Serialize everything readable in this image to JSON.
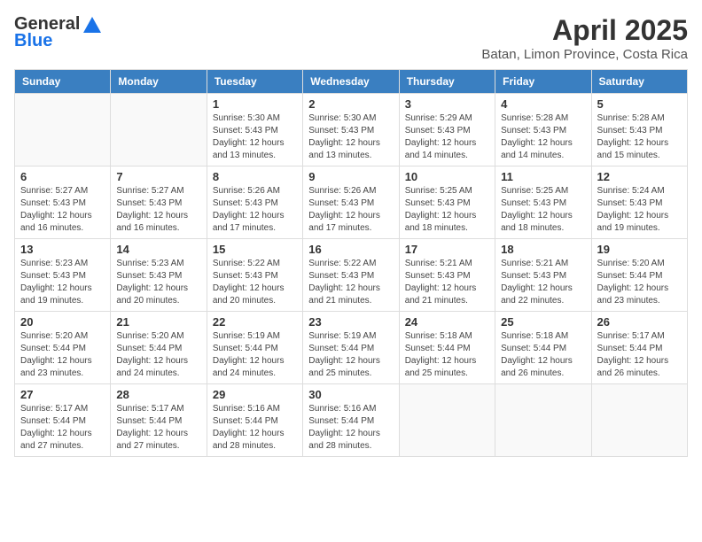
{
  "header": {
    "logo_general": "General",
    "logo_blue": "Blue",
    "month_title": "April 2025",
    "location": "Batan, Limon Province, Costa Rica"
  },
  "weekdays": [
    "Sunday",
    "Monday",
    "Tuesday",
    "Wednesday",
    "Thursday",
    "Friday",
    "Saturday"
  ],
  "weeks": [
    [
      {
        "day": "",
        "sunrise": "",
        "sunset": "",
        "daylight": ""
      },
      {
        "day": "",
        "sunrise": "",
        "sunset": "",
        "daylight": ""
      },
      {
        "day": "1",
        "sunrise": "Sunrise: 5:30 AM",
        "sunset": "Sunset: 5:43 PM",
        "daylight": "Daylight: 12 hours and 13 minutes."
      },
      {
        "day": "2",
        "sunrise": "Sunrise: 5:30 AM",
        "sunset": "Sunset: 5:43 PM",
        "daylight": "Daylight: 12 hours and 13 minutes."
      },
      {
        "day": "3",
        "sunrise": "Sunrise: 5:29 AM",
        "sunset": "Sunset: 5:43 PM",
        "daylight": "Daylight: 12 hours and 14 minutes."
      },
      {
        "day": "4",
        "sunrise": "Sunrise: 5:28 AM",
        "sunset": "Sunset: 5:43 PM",
        "daylight": "Daylight: 12 hours and 14 minutes."
      },
      {
        "day": "5",
        "sunrise": "Sunrise: 5:28 AM",
        "sunset": "Sunset: 5:43 PM",
        "daylight": "Daylight: 12 hours and 15 minutes."
      }
    ],
    [
      {
        "day": "6",
        "sunrise": "Sunrise: 5:27 AM",
        "sunset": "Sunset: 5:43 PM",
        "daylight": "Daylight: 12 hours and 16 minutes."
      },
      {
        "day": "7",
        "sunrise": "Sunrise: 5:27 AM",
        "sunset": "Sunset: 5:43 PM",
        "daylight": "Daylight: 12 hours and 16 minutes."
      },
      {
        "day": "8",
        "sunrise": "Sunrise: 5:26 AM",
        "sunset": "Sunset: 5:43 PM",
        "daylight": "Daylight: 12 hours and 17 minutes."
      },
      {
        "day": "9",
        "sunrise": "Sunrise: 5:26 AM",
        "sunset": "Sunset: 5:43 PM",
        "daylight": "Daylight: 12 hours and 17 minutes."
      },
      {
        "day": "10",
        "sunrise": "Sunrise: 5:25 AM",
        "sunset": "Sunset: 5:43 PM",
        "daylight": "Daylight: 12 hours and 18 minutes."
      },
      {
        "day": "11",
        "sunrise": "Sunrise: 5:25 AM",
        "sunset": "Sunset: 5:43 PM",
        "daylight": "Daylight: 12 hours and 18 minutes."
      },
      {
        "day": "12",
        "sunrise": "Sunrise: 5:24 AM",
        "sunset": "Sunset: 5:43 PM",
        "daylight": "Daylight: 12 hours and 19 minutes."
      }
    ],
    [
      {
        "day": "13",
        "sunrise": "Sunrise: 5:23 AM",
        "sunset": "Sunset: 5:43 PM",
        "daylight": "Daylight: 12 hours and 19 minutes."
      },
      {
        "day": "14",
        "sunrise": "Sunrise: 5:23 AM",
        "sunset": "Sunset: 5:43 PM",
        "daylight": "Daylight: 12 hours and 20 minutes."
      },
      {
        "day": "15",
        "sunrise": "Sunrise: 5:22 AM",
        "sunset": "Sunset: 5:43 PM",
        "daylight": "Daylight: 12 hours and 20 minutes."
      },
      {
        "day": "16",
        "sunrise": "Sunrise: 5:22 AM",
        "sunset": "Sunset: 5:43 PM",
        "daylight": "Daylight: 12 hours and 21 minutes."
      },
      {
        "day": "17",
        "sunrise": "Sunrise: 5:21 AM",
        "sunset": "Sunset: 5:43 PM",
        "daylight": "Daylight: 12 hours and 21 minutes."
      },
      {
        "day": "18",
        "sunrise": "Sunrise: 5:21 AM",
        "sunset": "Sunset: 5:43 PM",
        "daylight": "Daylight: 12 hours and 22 minutes."
      },
      {
        "day": "19",
        "sunrise": "Sunrise: 5:20 AM",
        "sunset": "Sunset: 5:44 PM",
        "daylight": "Daylight: 12 hours and 23 minutes."
      }
    ],
    [
      {
        "day": "20",
        "sunrise": "Sunrise: 5:20 AM",
        "sunset": "Sunset: 5:44 PM",
        "daylight": "Daylight: 12 hours and 23 minutes."
      },
      {
        "day": "21",
        "sunrise": "Sunrise: 5:20 AM",
        "sunset": "Sunset: 5:44 PM",
        "daylight": "Daylight: 12 hours and 24 minutes."
      },
      {
        "day": "22",
        "sunrise": "Sunrise: 5:19 AM",
        "sunset": "Sunset: 5:44 PM",
        "daylight": "Daylight: 12 hours and 24 minutes."
      },
      {
        "day": "23",
        "sunrise": "Sunrise: 5:19 AM",
        "sunset": "Sunset: 5:44 PM",
        "daylight": "Daylight: 12 hours and 25 minutes."
      },
      {
        "day": "24",
        "sunrise": "Sunrise: 5:18 AM",
        "sunset": "Sunset: 5:44 PM",
        "daylight": "Daylight: 12 hours and 25 minutes."
      },
      {
        "day": "25",
        "sunrise": "Sunrise: 5:18 AM",
        "sunset": "Sunset: 5:44 PM",
        "daylight": "Daylight: 12 hours and 26 minutes."
      },
      {
        "day": "26",
        "sunrise": "Sunrise: 5:17 AM",
        "sunset": "Sunset: 5:44 PM",
        "daylight": "Daylight: 12 hours and 26 minutes."
      }
    ],
    [
      {
        "day": "27",
        "sunrise": "Sunrise: 5:17 AM",
        "sunset": "Sunset: 5:44 PM",
        "daylight": "Daylight: 12 hours and 27 minutes."
      },
      {
        "day": "28",
        "sunrise": "Sunrise: 5:17 AM",
        "sunset": "Sunset: 5:44 PM",
        "daylight": "Daylight: 12 hours and 27 minutes."
      },
      {
        "day": "29",
        "sunrise": "Sunrise: 5:16 AM",
        "sunset": "Sunset: 5:44 PM",
        "daylight": "Daylight: 12 hours and 28 minutes."
      },
      {
        "day": "30",
        "sunrise": "Sunrise: 5:16 AM",
        "sunset": "Sunset: 5:44 PM",
        "daylight": "Daylight: 12 hours and 28 minutes."
      },
      {
        "day": "",
        "sunrise": "",
        "sunset": "",
        "daylight": ""
      },
      {
        "day": "",
        "sunrise": "",
        "sunset": "",
        "daylight": ""
      },
      {
        "day": "",
        "sunrise": "",
        "sunset": "",
        "daylight": ""
      }
    ]
  ]
}
